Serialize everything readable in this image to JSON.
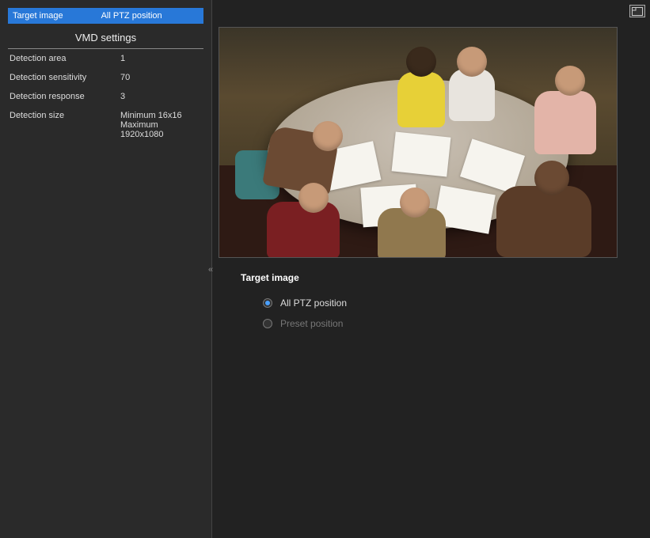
{
  "sidebar": {
    "header": {
      "left": "Target image",
      "right": "All PTZ position"
    },
    "section_title": "VMD settings",
    "rows": [
      {
        "label": "Detection area",
        "value": "1"
      },
      {
        "label": "Detection sensitivity",
        "value": "70"
      },
      {
        "label": "Detection response",
        "value": "3"
      },
      {
        "label": "Detection size",
        "value": "Minimum 16x16",
        "value2": "Maximum 1920x1080"
      }
    ]
  },
  "main": {
    "form": {
      "title": "Target image",
      "options": [
        {
          "label": "All PTZ position",
          "selected": true
        },
        {
          "label": "Preset position",
          "selected": false
        }
      ]
    }
  }
}
